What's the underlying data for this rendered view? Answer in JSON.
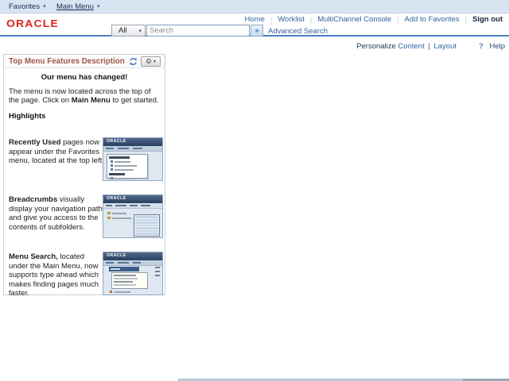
{
  "menubar": {
    "favorites_label": "Favorites",
    "main_menu_label": "Main Menu"
  },
  "header": {
    "logo": "ORACLE",
    "links": [
      "Home",
      "Worklist",
      "MultiChannel Console",
      "Add to Favorites"
    ],
    "signout_label": "Sign out",
    "search": {
      "scope_value": "All",
      "placeholder": "Search",
      "advanced_label": "Advanced Search"
    }
  },
  "personalize_bar": {
    "prefix": "Personalize",
    "content_label": "Content",
    "separator": "|",
    "layout_label": "Layout",
    "help_icon": "?",
    "help_label": "Help"
  },
  "pagelet": {
    "title": "Top Menu Features Description",
    "headline": "Our menu has changed!",
    "intro_pre": "The menu is now located across the top of the page. Click on ",
    "intro_bold": "Main Menu",
    "intro_post": " to get started.",
    "highlights_label": "Highlights",
    "features": [
      {
        "bold": "Recently Used",
        "text": " pages now appear under the Favorites menu, located at the top left."
      },
      {
        "bold": "Breadcrumbs",
        "text": " visually display your navigation path and give you access to the contents of subfolders."
      },
      {
        "bold": "Menu Search,",
        "text": " located under the Main Menu, now supports type ahead which makes finding pages much faster."
      }
    ],
    "thumb_logo": "ORACLE"
  },
  "icons": {
    "caret_down": "▾",
    "search_go": "»",
    "gear": "⚙",
    "link_separator": "|"
  },
  "colors": {
    "accent_blue": "#4b80c2",
    "topbar_bg": "#d8e4f2",
    "link_blue": "#33639c",
    "oracle_red": "#e0231c",
    "pagelet_title": "#a2564b"
  }
}
